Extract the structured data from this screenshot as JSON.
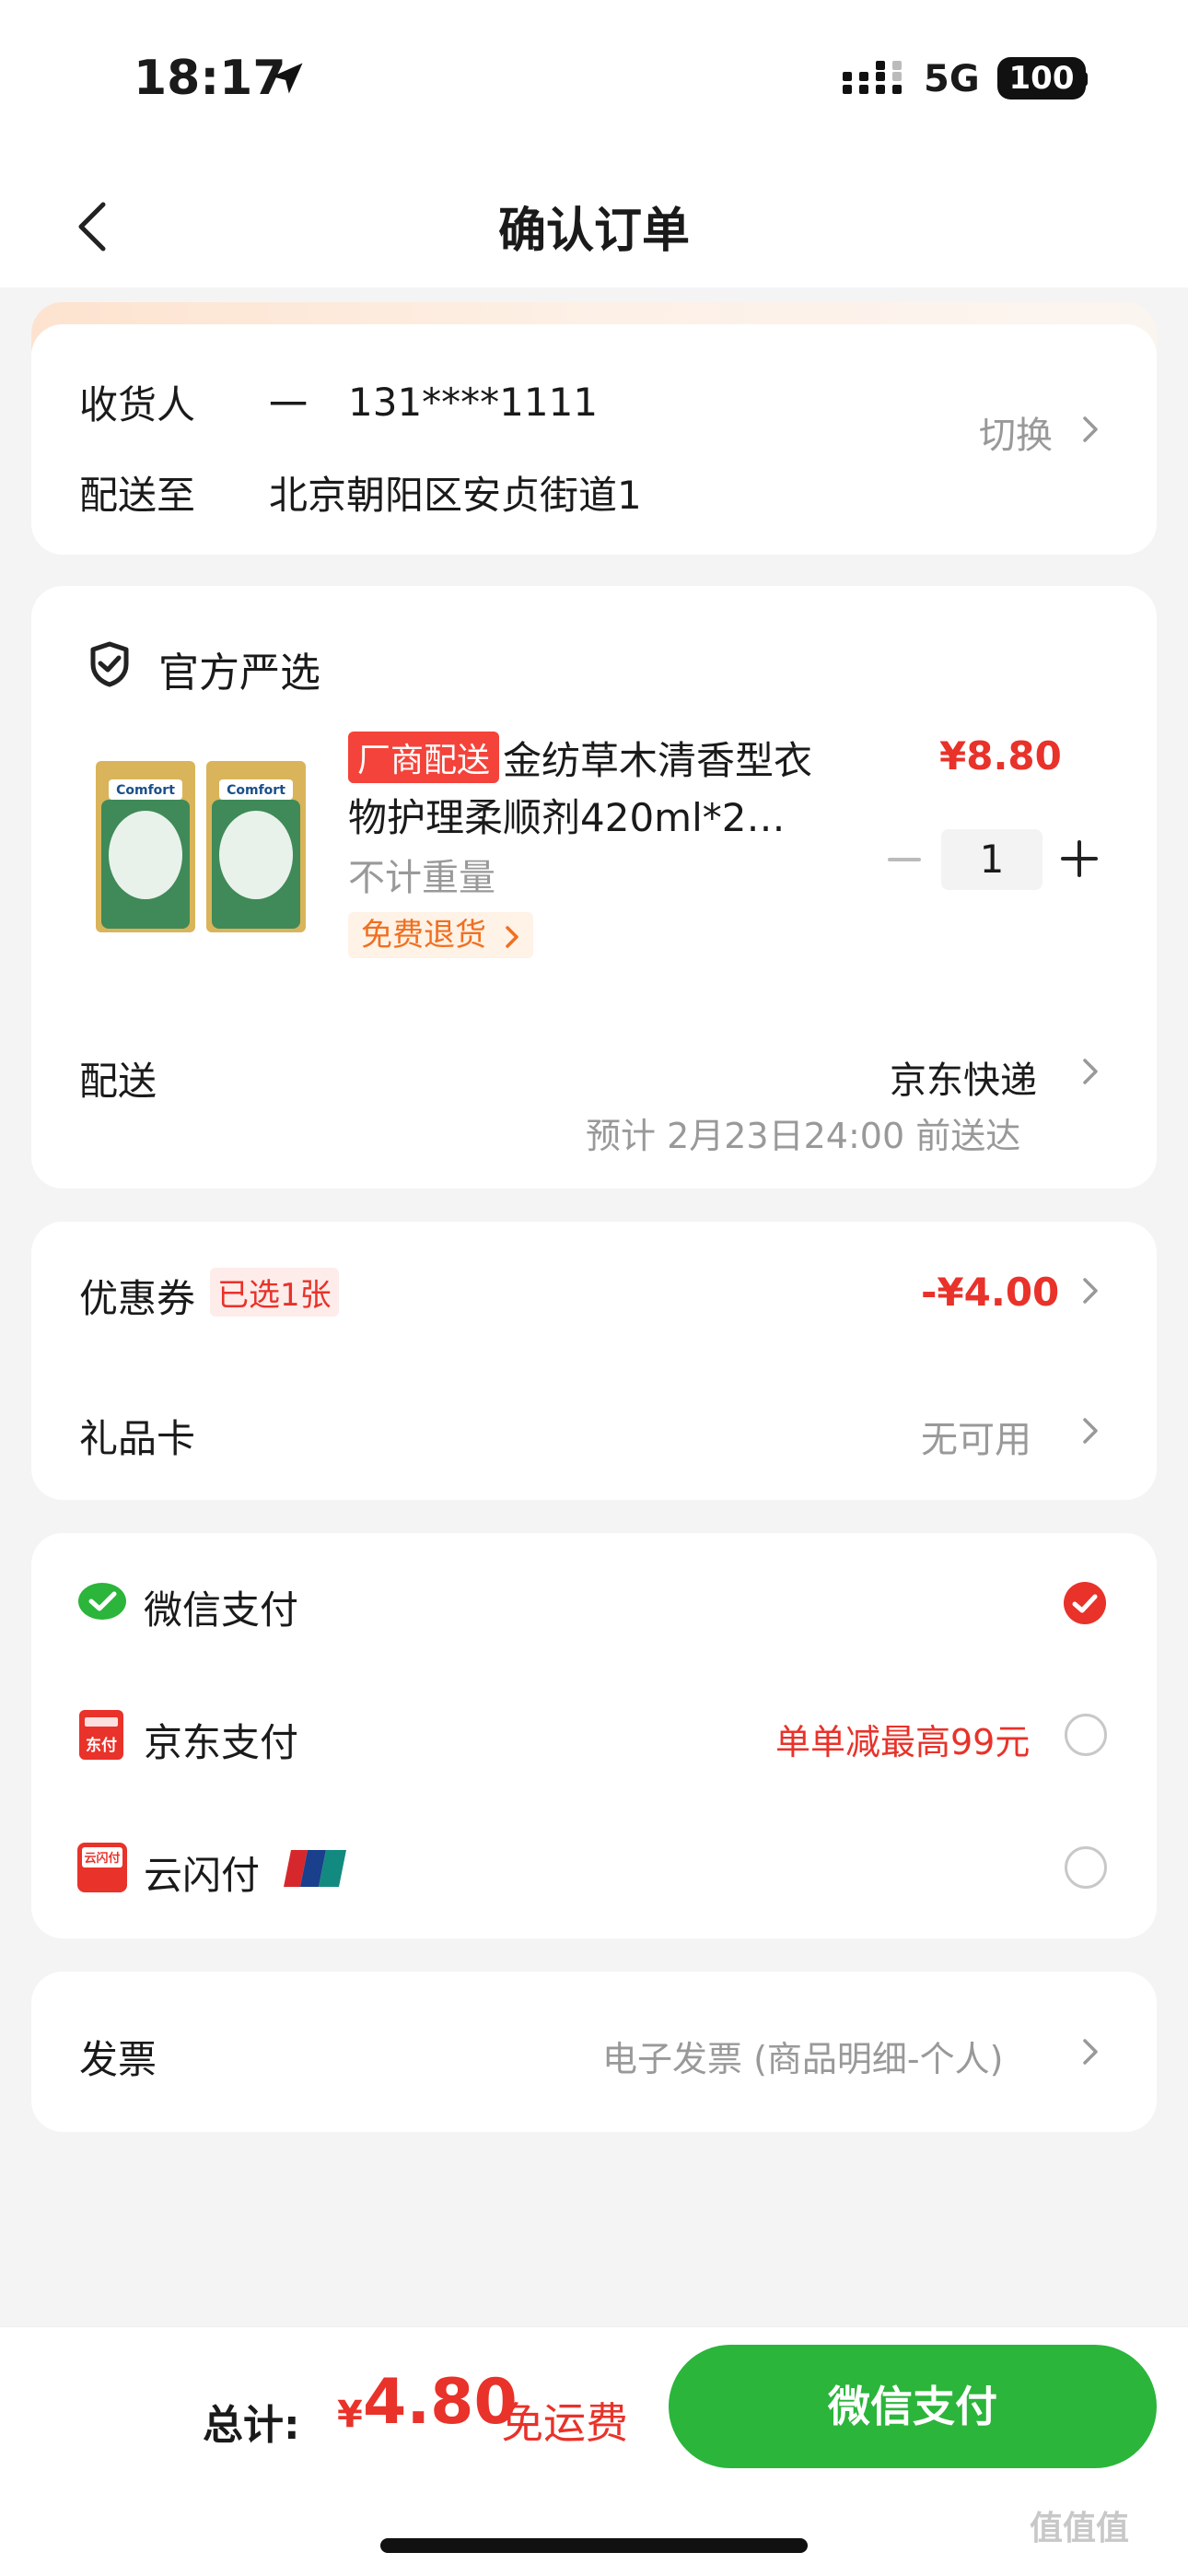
{
  "status_bar": {
    "time": "18:17",
    "network": "5G",
    "battery": "100"
  },
  "nav": {
    "title": "确认订单"
  },
  "address": {
    "recipient_label": "收货人",
    "recipient_name": "一",
    "phone": "131****1111",
    "deliver_label": "配送至",
    "address": "北京朝阳区安贞街道1",
    "switch_label": "切换"
  },
  "store": {
    "name": "官方严选"
  },
  "product": {
    "tag": "厂商配送",
    "title_line1": "金纺草木清香型衣",
    "title_line2": "物护理柔顺剂420ml*2…",
    "weight": "不计重量",
    "return_label": "免费退货",
    "price": "¥8.80",
    "quantity": "1",
    "brand_text": "Comfort 金纺"
  },
  "delivery": {
    "label": "配送",
    "method": "京东快递",
    "eta": "预计 2月23日24:00 前送达"
  },
  "discounts": {
    "coupon_label": "优惠券",
    "coupon_tag": "已选1张",
    "coupon_value": "-¥4.00",
    "giftcard_label": "礼品卡",
    "giftcard_value": "无可用"
  },
  "payment": {
    "options": [
      {
        "label": "微信支付",
        "icon": "wechat-pay-icon",
        "selected": true
      },
      {
        "label": "京东支付",
        "icon": "jd-pay-icon",
        "promo": "单单减最高99元",
        "selected": false
      },
      {
        "label": "云闪付",
        "icon": "unionpay-cloud-icon",
        "selected": false
      }
    ],
    "wechat_color": "#2bb53b",
    "accent_color": "#e8322a"
  },
  "invoice": {
    "label": "发票",
    "value": "电子发票 (商品明细-个人)"
  },
  "footer": {
    "total_label": "总计:",
    "currency": "¥",
    "total_amount": "4.80",
    "shipping_note": "免运费",
    "pay_button": "微信支付"
  },
  "watermark": "值值值"
}
